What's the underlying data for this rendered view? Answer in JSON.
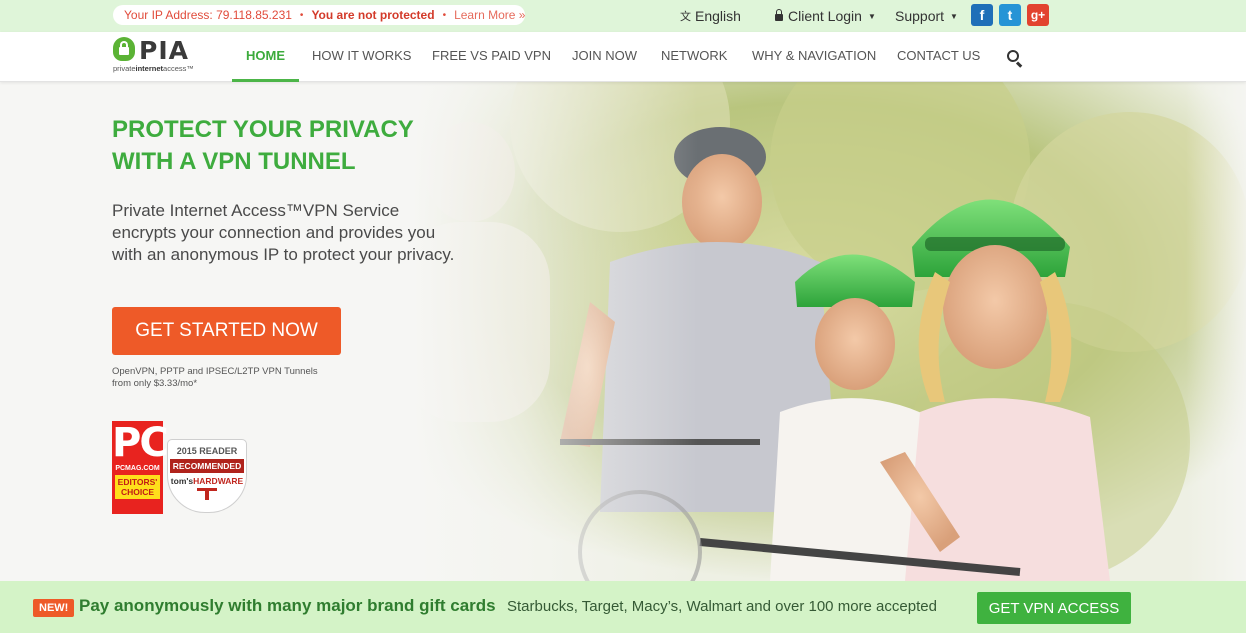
{
  "topbar": {
    "ip_label": "Your IP Address: 79.118.85.231",
    "separator": "•",
    "protection_status": "You are not protected",
    "learn_more": "Learn More »",
    "language": "English",
    "client_login": "Client Login",
    "support": "Support",
    "social": [
      {
        "name": "facebook-icon",
        "glyph": "f",
        "color": "#1f6fb8"
      },
      {
        "name": "twitter-icon",
        "glyph": "t",
        "color": "#2694d6"
      },
      {
        "name": "google-plus-icon",
        "glyph": "g+",
        "color": "#e2432f"
      }
    ]
  },
  "logo": {
    "mark": "PIA",
    "subtitle_pre": "private",
    "subtitle_bold": "internet",
    "subtitle_post": "access™"
  },
  "nav": {
    "items": [
      {
        "label": "HOME",
        "active": true
      },
      {
        "label": "HOW IT WORKS",
        "active": false
      },
      {
        "label": "FREE VS PAID VPN",
        "active": false
      },
      {
        "label": "JOIN NOW",
        "active": false
      },
      {
        "label": "NETWORK",
        "active": false
      },
      {
        "label": "WHY & NAVIGATION",
        "active": false
      },
      {
        "label": "CONTACT US",
        "active": false
      }
    ],
    "search_icon": "search-icon"
  },
  "hero": {
    "title_line1": "PROTECT YOUR PRIVACY",
    "title_line2": "WITH A VPN TUNNEL",
    "description": "Private Internet Access™VPN Service encrypts your connection and provides you with an anonymous IP to protect your privacy.",
    "cta_label": "GET STARTED NOW",
    "note_line1": "OpenVPN, PPTP and IPSEC/L2TP VPN Tunnels",
    "note_line2": "from only $3.33/mo*"
  },
  "badges": {
    "pc_big": "PC",
    "pc_small": "PCMAG.COM",
    "pc_editors_1": "EDITORS'",
    "pc_editors_2": "CHOICE",
    "th_year": "2015 READER",
    "th_rec": "RECOMMENDED",
    "th_brand_pre": "tom's",
    "th_brand_post": "HARDWARE"
  },
  "promo": {
    "new_label": "NEW!",
    "headline": "Pay anonymously with many major brand gift cards",
    "text": "Starbucks, Target, Macy’s, Walmart and over 100 more accepted",
    "button": "GET VPN ACCESS"
  },
  "colors": {
    "brand_green": "#3eac3e",
    "cta_orange": "#ee5a28",
    "topbar_bg": "#dff5d9",
    "promo_bg": "#d4f3c7"
  }
}
